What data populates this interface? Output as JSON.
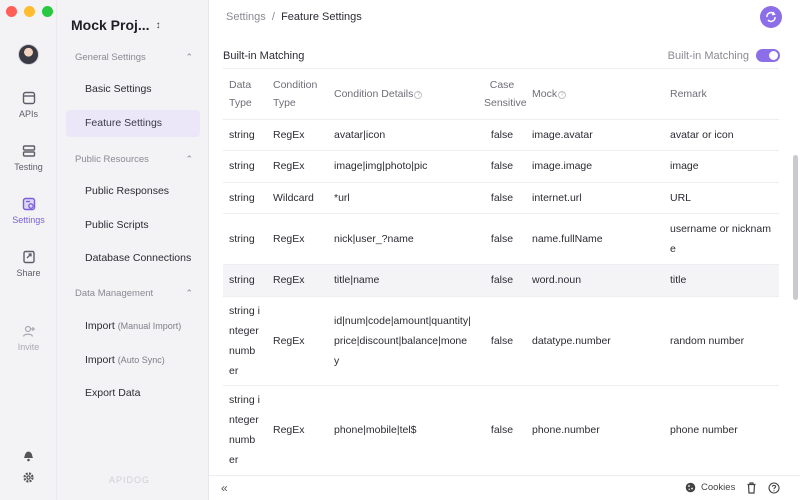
{
  "rail": {
    "items": [
      {
        "label": "APIs",
        "icon": "api-icon"
      },
      {
        "label": "Testing",
        "icon": "testing-icon"
      },
      {
        "label": "Settings",
        "icon": "settings-icon"
      },
      {
        "label": "Share",
        "icon": "share-icon"
      },
      {
        "label": "Invite",
        "icon": "invite-icon"
      }
    ]
  },
  "sidebar": {
    "project_name": "Mock Proj...",
    "sections": [
      {
        "title": "General Settings",
        "items": [
          {
            "label": "Basic Settings"
          },
          {
            "label": "Feature Settings"
          }
        ]
      },
      {
        "title": "Public Resources",
        "items": [
          {
            "label": "Public Responses"
          },
          {
            "label": "Public Scripts"
          },
          {
            "label": "Database Connections"
          }
        ]
      },
      {
        "title": "Data Management",
        "items": [
          {
            "label": "Import",
            "sub": "(Manual Import)"
          },
          {
            "label": "Import",
            "sub": "(Auto Sync)"
          },
          {
            "label": "Export Data"
          }
        ]
      }
    ],
    "brand": "APIDOG"
  },
  "breadcrumb": {
    "root": "Settings",
    "sep": "/",
    "current": "Feature Settings"
  },
  "section": {
    "title": "Built-in Matching",
    "toggle_label": "Built-in Matching",
    "toggle_on": true
  },
  "table": {
    "headers": {
      "data_type": "Data Type",
      "condition_type": "Condition Type",
      "condition_details": "Condition Details",
      "case_sensitive": "Case Sensitive",
      "mock": "Mock",
      "remark": "Remark"
    },
    "rows": [
      {
        "data_type": "string",
        "condition_type": "RegEx",
        "condition_details": "avatar|icon",
        "case_sensitive": "false",
        "mock": "image.avatar",
        "remark": "avatar or icon"
      },
      {
        "data_type": "string",
        "condition_type": "RegEx",
        "condition_details": "image|img|photo|pic",
        "case_sensitive": "false",
        "mock": "image.image",
        "remark": "image"
      },
      {
        "data_type": "string",
        "condition_type": "Wildcard",
        "condition_details": "*url",
        "case_sensitive": "false",
        "mock": "internet.url",
        "remark": "URL"
      },
      {
        "data_type": "string",
        "condition_type": "RegEx",
        "condition_details": "nick|user_?name",
        "case_sensitive": "false",
        "mock": "name.fullName",
        "remark": "username or nickname"
      },
      {
        "data_type": "string",
        "condition_type": "RegEx",
        "condition_details": "title|name",
        "case_sensitive": "false",
        "mock": "word.noun",
        "remark": "title"
      },
      {
        "data_type": "string integer number",
        "condition_type": "RegEx",
        "condition_details": "id|num|code|amount|quantity|price|discount|balance|money",
        "case_sensitive": "false",
        "mock": "datatype.number",
        "remark": "random number"
      },
      {
        "data_type": "string integer number",
        "condition_type": "RegEx",
        "condition_details": "phone|mobile|tel$",
        "case_sensitive": "false",
        "mock": "phone.number",
        "remark": "phone number"
      }
    ]
  },
  "footer": {
    "cookies_label": "Cookies"
  },
  "colors": {
    "accent": "#8c6ee8",
    "active_bg": "#ebe7f8",
    "sidebar_bg": "#f3f3f5"
  }
}
